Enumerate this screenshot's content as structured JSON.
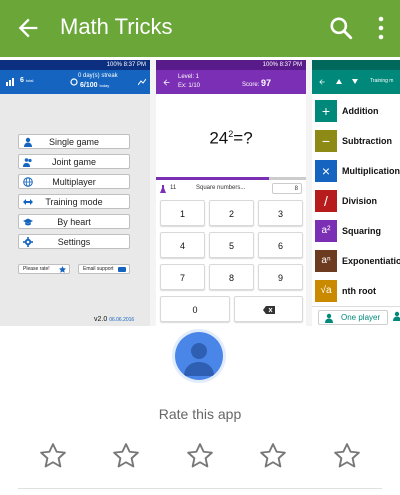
{
  "appbar": {
    "title": "Math Tricks",
    "color": "#6aa638"
  },
  "shot1": {
    "status": "100% 8:37 PM",
    "total_count": "6",
    "total_unit": "total",
    "daily_label": "0 day(s) streak",
    "daily_score": "6/100",
    "daily_unit": "today",
    "menu": [
      "Single game",
      "Joint game",
      "Multiplayer",
      "Training mode",
      "By heart",
      "Settings"
    ],
    "rate_button": "Please rate!",
    "email_button": "Email support",
    "version": "v2.0",
    "date": "06.06.2016"
  },
  "shot2": {
    "status": "100% 8:37 PM",
    "level": "Level: 1",
    "exercise": "Ex: 1/10",
    "score_label": "Score:",
    "score": "97",
    "question_base": "24",
    "question_exp": "2",
    "question_tail": "=?",
    "info_count": "11",
    "info_text": "Square numbers...",
    "info_badge": "8",
    "keys": [
      "1",
      "2",
      "3",
      "4",
      "5",
      "6",
      "7",
      "8",
      "9",
      "0"
    ]
  },
  "shot3": {
    "topbar_text": "Training m",
    "items": [
      {
        "label": "Addition",
        "symbol": "+",
        "color": "#00897b"
      },
      {
        "label": "Subtraction",
        "symbol": "−",
        "color": "#8d8a16"
      },
      {
        "label": "Multiplication",
        "symbol": "×",
        "color": "#1565c0"
      },
      {
        "label": "Division",
        "symbol": "/",
        "color": "#b71c1c"
      },
      {
        "label": "Squaring",
        "symbol": "a²",
        "color": "#7b2fb5"
      },
      {
        "label": "Exponentiation",
        "symbol": "aⁿ",
        "color": "#6d3b1f"
      },
      {
        "label": "nth root",
        "symbol": "√a",
        "color": "#c98a00"
      }
    ],
    "one_player": "One player"
  },
  "rating": {
    "label": "Rate this app",
    "stars": 5
  }
}
